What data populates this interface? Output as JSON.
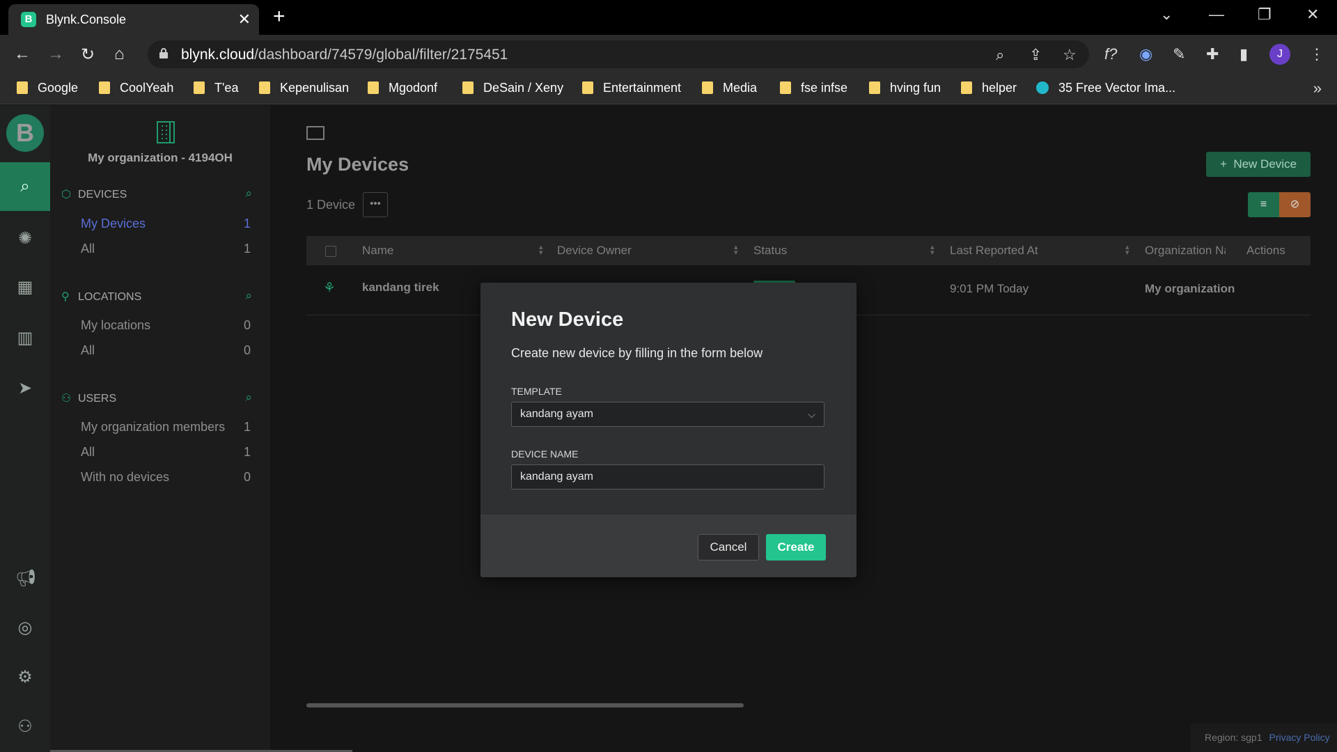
{
  "browser": {
    "tab_title": "Blynk.Console",
    "tab_favicon": "B",
    "url_host": "blynk.cloud",
    "url_path": "/dashboard/74579/global/filter/2175451",
    "profile_initial": "J",
    "bookmarks": [
      "Google",
      "CoolYeah",
      "T'ea",
      "Kepenulisan",
      "Mgodonf",
      "DeSain / Xeny",
      "Entertainment",
      "Media",
      "fse infse",
      "hving fun",
      "helper",
      "35 Free Vector Ima..."
    ]
  },
  "rail": {
    "logo": "B",
    "icons": [
      "search-icon",
      "sun-icon",
      "grid-icon",
      "building-icon",
      "send-icon",
      "megaphone-icon",
      "lifebuoy-icon",
      "gear-icon",
      "user-icon"
    ]
  },
  "sidebar": {
    "org_name": "My organization - 4194OH",
    "devices": {
      "title": "DEVICES",
      "items": [
        {
          "label": "My Devices",
          "count": "1"
        },
        {
          "label": "All",
          "count": "1"
        }
      ]
    },
    "locations": {
      "title": "LOCATIONS",
      "items": [
        {
          "label": "My locations",
          "count": "0"
        },
        {
          "label": "All",
          "count": "0"
        }
      ]
    },
    "users": {
      "title": "USERS",
      "items": [
        {
          "label": "My organization members",
          "count": "1"
        },
        {
          "label": "All",
          "count": "1"
        },
        {
          "label": "With no devices",
          "count": "0"
        }
      ]
    }
  },
  "main": {
    "title": "My Devices",
    "new_device_label": "New Device",
    "count_label": "1 Device",
    "more_label": "•••",
    "columns": [
      "Name",
      "Device Owner",
      "Status",
      "Last Reported At",
      "Organization Nai",
      "Actions"
    ],
    "rows": [
      {
        "name": "kandang tirek",
        "last_reported": "9:01 PM Today",
        "organization": "My organization"
      }
    ]
  },
  "footer": {
    "region": "Region: sgp1",
    "privacy": "Privacy Policy"
  },
  "modal": {
    "title": "New Device",
    "subtitle": "Create new device by filling in the form below",
    "template_label": "TEMPLATE",
    "template_value": "kandang ayam",
    "device_name_label": "DEVICE NAME",
    "device_name_value": "kandang ayam",
    "cancel_label": "Cancel",
    "create_label": "Create"
  },
  "colors": {
    "accent": "#23c48e",
    "link": "#5b6fd6"
  }
}
